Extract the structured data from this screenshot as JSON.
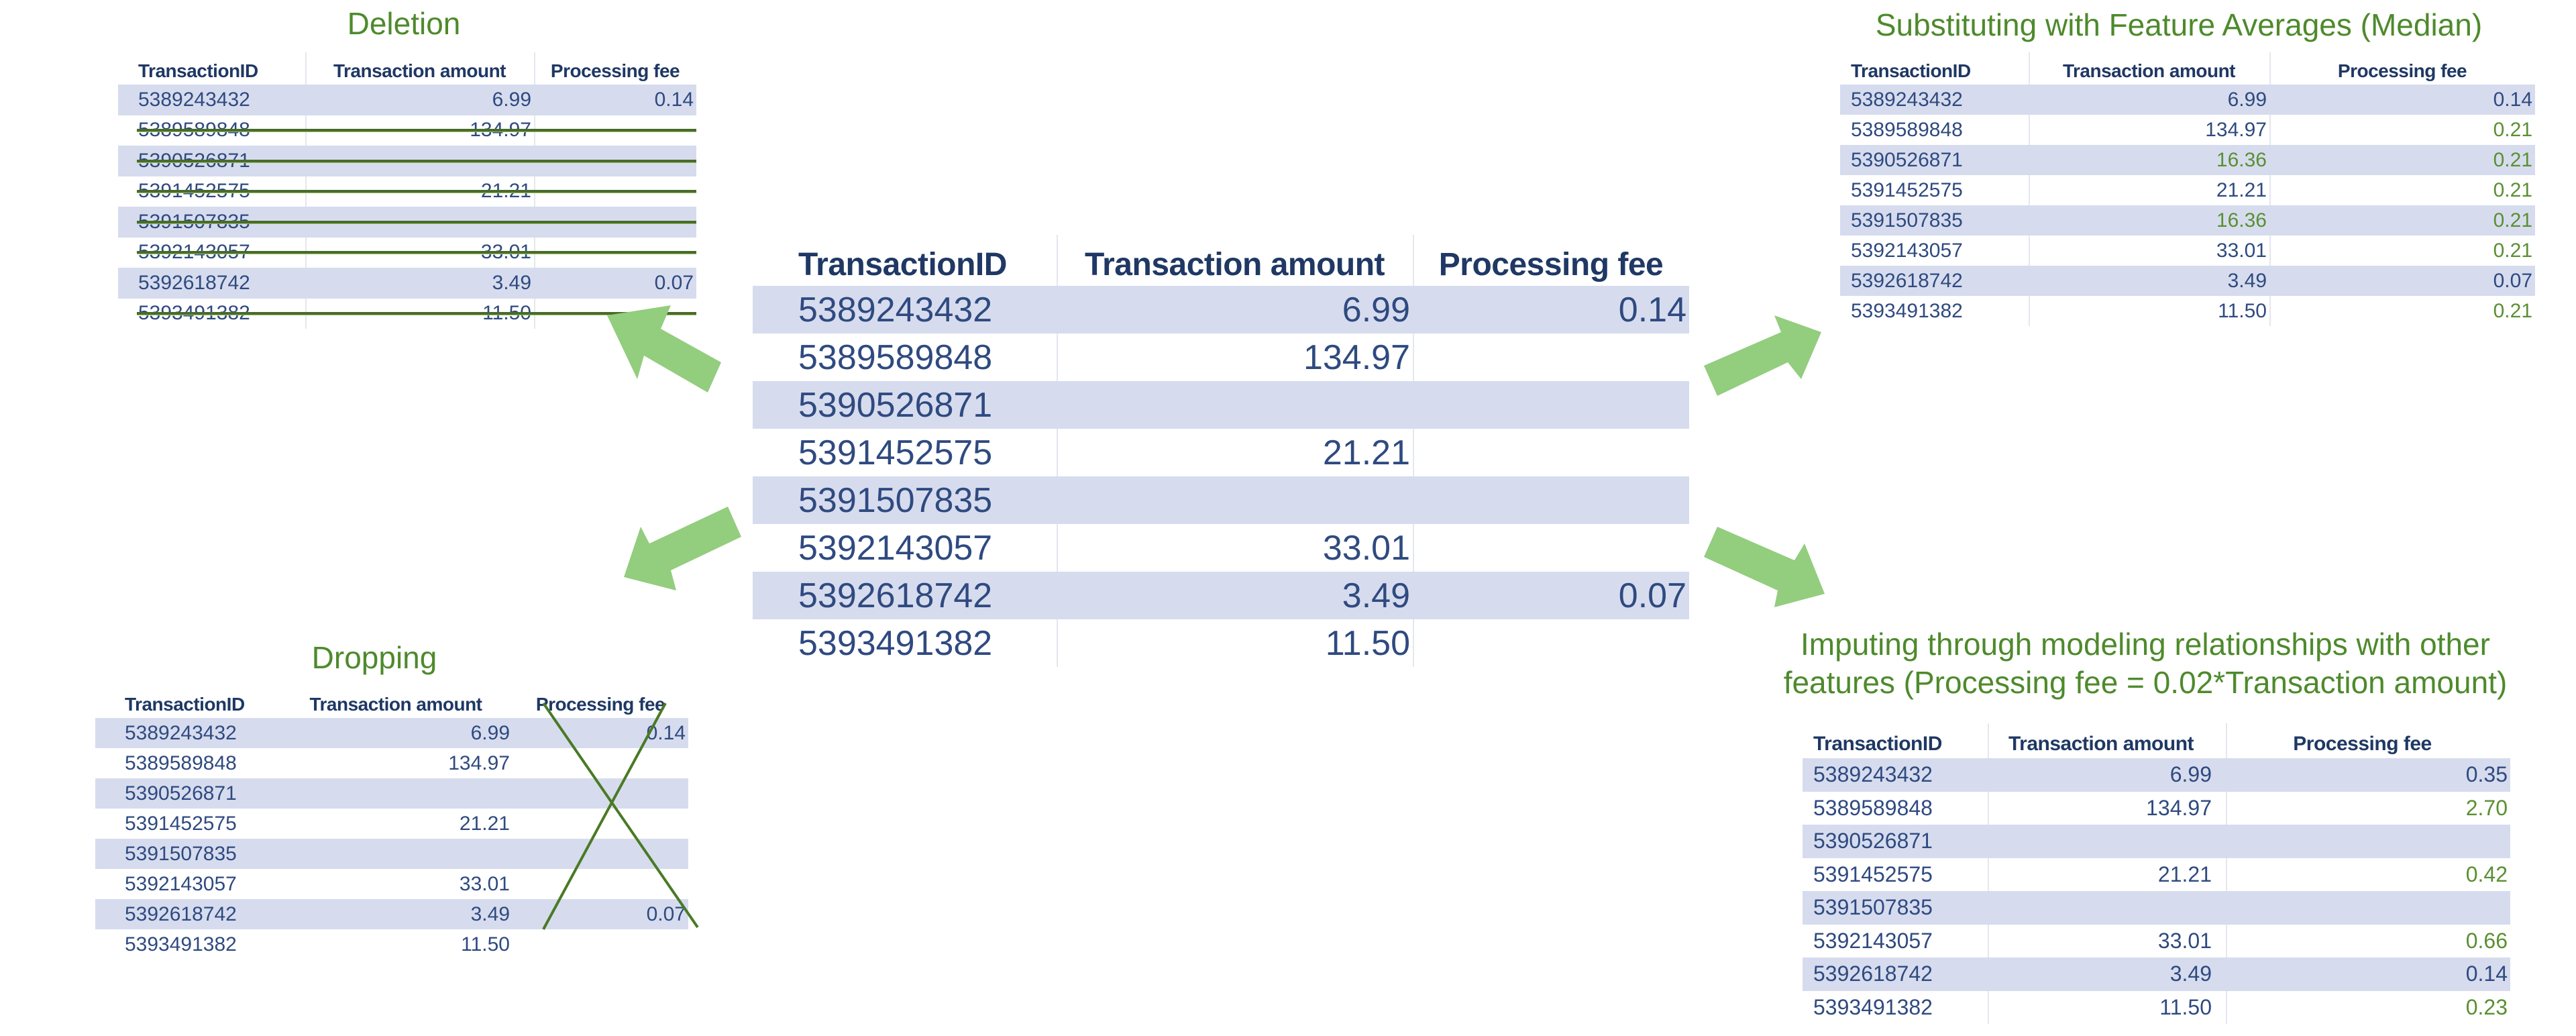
{
  "colors": {
    "title_green": "#4e8a2c",
    "header_text": "#1f3864",
    "cell_text": "#2f4a80",
    "imputed_green": "#5b8f32",
    "band": "#d6dcee",
    "arrow": "#93cd7e",
    "strike_line": "#4a6b2a"
  },
  "columns": [
    "TransactionID",
    "Transaction amount",
    "Processing fee"
  ],
  "original": {
    "rows": [
      {
        "id": "5389243432",
        "amount": "6.99",
        "fee": "0.14"
      },
      {
        "id": "5389589848",
        "amount": "134.97",
        "fee": ""
      },
      {
        "id": "5390526871",
        "amount": "",
        "fee": ""
      },
      {
        "id": "5391452575",
        "amount": "21.21",
        "fee": ""
      },
      {
        "id": "5391507835",
        "amount": "",
        "fee": ""
      },
      {
        "id": "5392143057",
        "amount": "33.01",
        "fee": ""
      },
      {
        "id": "5392618742",
        "amount": "3.49",
        "fee": "0.07"
      },
      {
        "id": "5393491382",
        "amount": "11.50",
        "fee": ""
      }
    ]
  },
  "deletion": {
    "title": "Deletion",
    "rows": [
      {
        "id": "5389243432",
        "amount": "6.99",
        "fee": "0.14",
        "struck": false
      },
      {
        "id": "5389589848",
        "amount": "134.97",
        "fee": "",
        "struck": true
      },
      {
        "id": "5390526871",
        "amount": "",
        "fee": "",
        "struck": true
      },
      {
        "id": "5391452575",
        "amount": "21.21",
        "fee": "",
        "struck": true
      },
      {
        "id": "5391507835",
        "amount": "",
        "fee": "",
        "struck": true
      },
      {
        "id": "5392143057",
        "amount": "33.01",
        "fee": "",
        "struck": true
      },
      {
        "id": "5392618742",
        "amount": "3.49",
        "fee": "0.07",
        "struck": false
      },
      {
        "id": "5393491382",
        "amount": "11.50",
        "fee": "",
        "struck": true
      }
    ]
  },
  "dropping": {
    "title": "Dropping",
    "dropped_column": "Processing fee",
    "rows": [
      {
        "id": "5389243432",
        "amount": "6.99",
        "fee": "0.14"
      },
      {
        "id": "5389589848",
        "amount": "134.97",
        "fee": ""
      },
      {
        "id": "5390526871",
        "amount": "",
        "fee": ""
      },
      {
        "id": "5391452575",
        "amount": "21.21",
        "fee": ""
      },
      {
        "id": "5391507835",
        "amount": "",
        "fee": ""
      },
      {
        "id": "5392143057",
        "amount": "33.01",
        "fee": ""
      },
      {
        "id": "5392618742",
        "amount": "3.49",
        "fee": "0.07"
      },
      {
        "id": "5393491382",
        "amount": "11.50",
        "fee": ""
      }
    ]
  },
  "median": {
    "title": "Substituting with Feature Averages (Median)",
    "rows": [
      {
        "id": "5389243432",
        "amount": "6.99",
        "fee": "0.14",
        "amount_imputed": false,
        "fee_imputed": false
      },
      {
        "id": "5389589848",
        "amount": "134.97",
        "fee": "0.21",
        "amount_imputed": false,
        "fee_imputed": true
      },
      {
        "id": "5390526871",
        "amount": "16.36",
        "fee": "0.21",
        "amount_imputed": true,
        "fee_imputed": true
      },
      {
        "id": "5391452575",
        "amount": "21.21",
        "fee": "0.21",
        "amount_imputed": false,
        "fee_imputed": true
      },
      {
        "id": "5391507835",
        "amount": "16.36",
        "fee": "0.21",
        "amount_imputed": true,
        "fee_imputed": true
      },
      {
        "id": "5392143057",
        "amount": "33.01",
        "fee": "0.21",
        "amount_imputed": false,
        "fee_imputed": true
      },
      {
        "id": "5392618742",
        "amount": "3.49",
        "fee": "0.07",
        "amount_imputed": false,
        "fee_imputed": false
      },
      {
        "id": "5393491382",
        "amount": "11.50",
        "fee": "0.21",
        "amount_imputed": false,
        "fee_imputed": true
      }
    ]
  },
  "modeling": {
    "title_line1": "Imputing through modeling relationships with other",
    "title_line2": "features (Processing fee = 0.02*Transaction amount)",
    "rows": [
      {
        "id": "5389243432",
        "amount": "6.99",
        "fee": "0.35",
        "fee_imputed": false
      },
      {
        "id": "5389589848",
        "amount": "134.97",
        "fee": "2.70",
        "fee_imputed": true
      },
      {
        "id": "5390526871",
        "amount": "",
        "fee": "",
        "fee_imputed": false
      },
      {
        "id": "5391452575",
        "amount": "21.21",
        "fee": "0.42",
        "fee_imputed": true
      },
      {
        "id": "5391507835",
        "amount": "",
        "fee": "",
        "fee_imputed": false
      },
      {
        "id": "5392143057",
        "amount": "33.01",
        "fee": "0.66",
        "fee_imputed": true
      },
      {
        "id": "5392618742",
        "amount": "3.49",
        "fee": "0.14",
        "fee_imputed": false
      },
      {
        "id": "5393491382",
        "amount": "11.50",
        "fee": "0.23",
        "fee_imputed": true
      }
    ]
  },
  "arrows": [
    {
      "name": "arrow-to-deletion",
      "direction": "up-left"
    },
    {
      "name": "arrow-to-dropping",
      "direction": "down-left"
    },
    {
      "name": "arrow-to-median",
      "direction": "up-right"
    },
    {
      "name": "arrow-to-modeling",
      "direction": "down-right"
    }
  ]
}
